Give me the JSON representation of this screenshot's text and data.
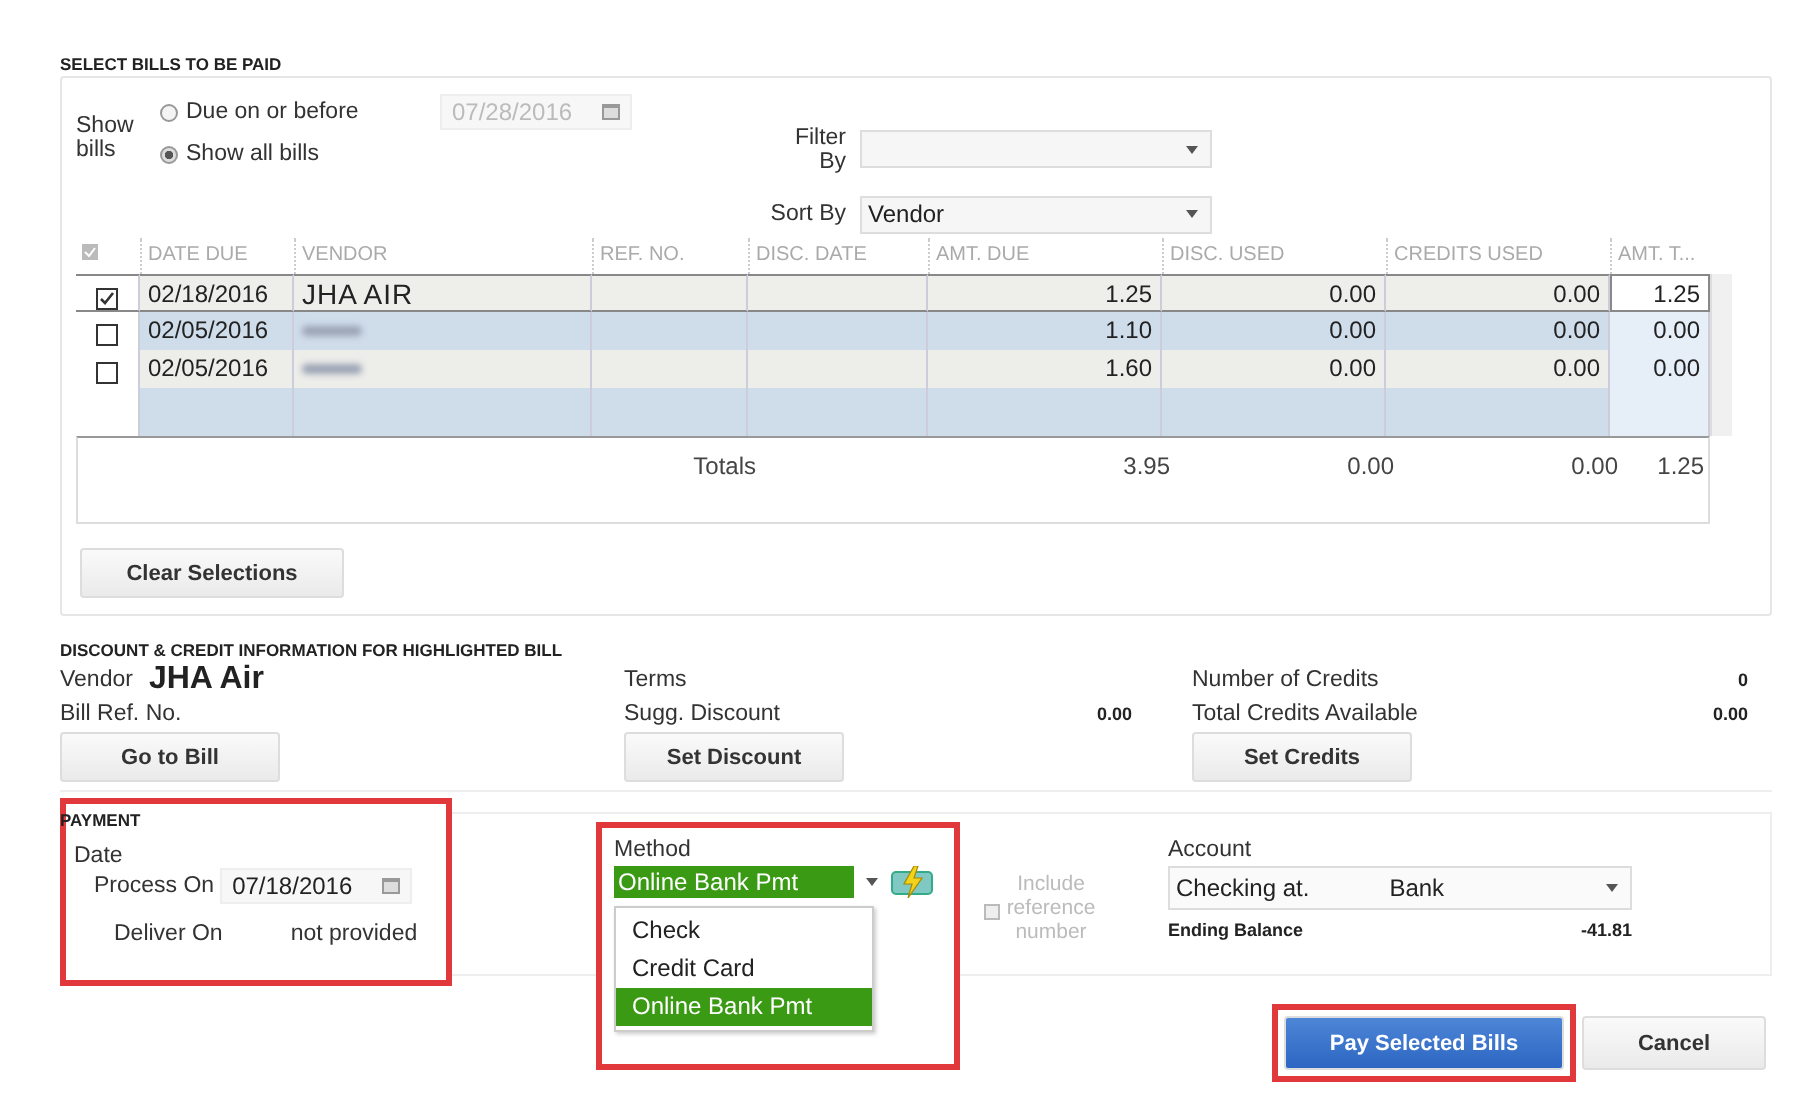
{
  "select_bills": {
    "title": "SELECT BILLS TO BE PAID",
    "show_bills_label": "Show bills",
    "options": [
      {
        "label": "Due on or before",
        "selected": false
      },
      {
        "label": "Show all bills",
        "selected": true
      }
    ],
    "due_date": {
      "value": "07/28/2016",
      "disabled": true
    },
    "filter_by": {
      "label": "Filter By"
    },
    "sort_by": {
      "label": "Sort By",
      "value": "Vendor"
    }
  },
  "table": {
    "columns": [
      "DATE DUE",
      "VENDOR",
      "REF. NO.",
      "DISC. DATE",
      "AMT. DUE",
      "DISC. USED",
      "CREDITS USED",
      "AMT. T..."
    ],
    "rows": [
      {
        "checked": true,
        "selected": true,
        "date_due": "02/18/2016",
        "vendor": "JHA AIR",
        "vendor_blurred": false,
        "amt_due": "1.25",
        "disc_used": "0.00",
        "credits_used": "0.00",
        "amt_to_pay": "1.25"
      },
      {
        "checked": false,
        "selected": false,
        "date_due": "02/05/2016",
        "vendor_blurred": true,
        "amt_due": "1.10",
        "disc_used": "0.00",
        "credits_used": "0.00",
        "amt_to_pay": "0.00"
      },
      {
        "checked": false,
        "selected": false,
        "date_due": "02/05/2016",
        "vendor_blurred": true,
        "amt_due": "1.60",
        "disc_used": "0.00",
        "credits_used": "0.00",
        "amt_to_pay": "0.00"
      }
    ],
    "totals": {
      "label": "Totals",
      "amt_due": "3.95",
      "disc_used": "0.00",
      "credits_used": "0.00",
      "amt_to_pay": "1.25"
    }
  },
  "clear_button": "Clear Selections",
  "discount_credit": {
    "title": "DISCOUNT & CREDIT INFORMATION FOR HIGHLIGHTED BILL",
    "vendor_label": "Vendor",
    "vendor": "JHA Air",
    "bill_ref_label": "Bill Ref. No.",
    "go_to_bill_button": "Go to Bill",
    "terms_label": "Terms",
    "sugg_discount_label": "Sugg. Discount",
    "sugg_discount": "0.00",
    "set_discount_button": "Set Discount",
    "number_of_credits_label": "Number of Credits",
    "number_of_credits": "0",
    "total_credits_label": "Total Credits Available",
    "total_credits": "0.00",
    "set_credits_button": "Set Credits"
  },
  "payment": {
    "title": "PAYMENT",
    "date_label": "Date",
    "process_on_label": "Process On",
    "process_on": "07/18/2016",
    "deliver_on_label": "Deliver On",
    "deliver_on": "not provided",
    "date_highlighted": true,
    "method_label": "Method",
    "method_value": "Online Bank Pmt",
    "method_highlighted": true,
    "method_options": [
      {
        "label": "Check",
        "selected": false
      },
      {
        "label": "Credit Card",
        "selected": false
      },
      {
        "label": "Online Bank Pmt",
        "selected": true
      }
    ],
    "include_reference": {
      "label": "Include reference number",
      "disabled": true,
      "checked": false
    },
    "account_label": "Account",
    "account_value": [
      "Checking at.",
      "Bank"
    ],
    "ending_balance_label": "Ending Balance",
    "ending_balance": "-41.81"
  },
  "buttons": [
    {
      "label": "Pay Selected Bills",
      "kind": "primary",
      "highlighted": true
    },
    {
      "label": "Cancel",
      "kind": "plain",
      "highlighted": false
    }
  ]
}
